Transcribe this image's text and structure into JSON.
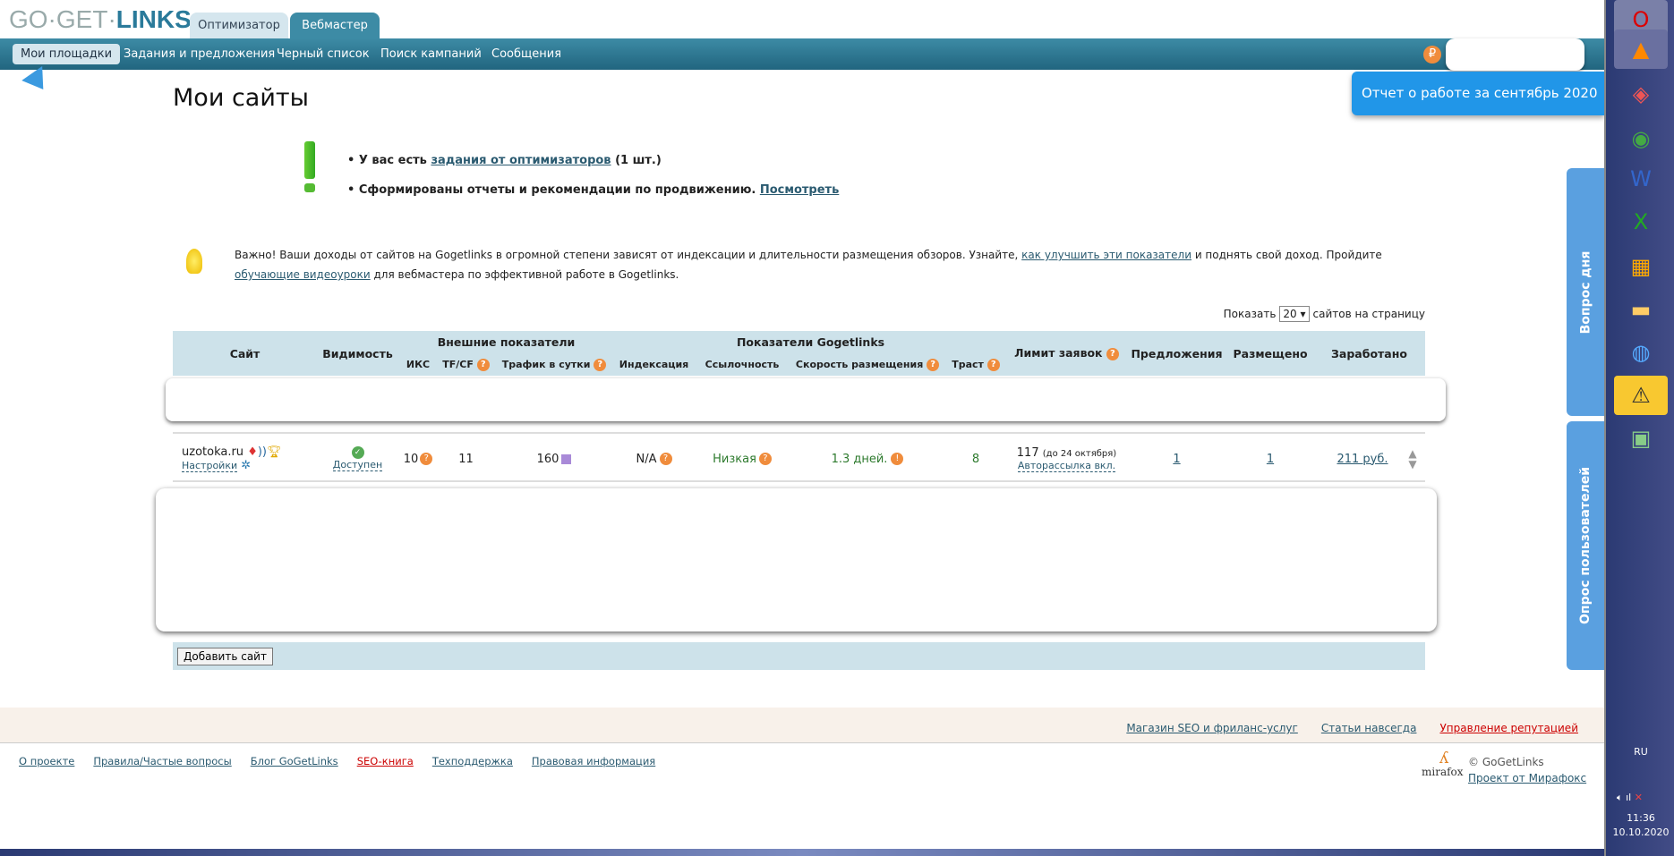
{
  "logo": {
    "part1": "GO·GET·",
    "part2": "LINKS"
  },
  "top_tabs": [
    {
      "label": "Оптимизатор"
    },
    {
      "label": "Вебмастер"
    }
  ],
  "nav": [
    {
      "label": "Мои площадки"
    },
    {
      "label": "Задания и предложения"
    },
    {
      "label": "Черный список"
    },
    {
      "label": "Поиск кампаний"
    },
    {
      "label": "Сообщения"
    }
  ],
  "balance_icon": "ruble-icon",
  "report_button": "Отчет о работе за сентябрь 2020",
  "page_title": "Мои сайты",
  "notices": {
    "n1_pre": "У вас есть ",
    "n1_link": "задания от оптимизаторов",
    "n1_post": " (1 шт.)",
    "n2_pre": "Сформированы отчеты и рекомендации по продвижению. ",
    "n2_link": "Посмотреть"
  },
  "tip": {
    "t1": "Важно! Ваши доходы от сайтов на Gogetlinks в огромной степени зависят от индексации и длительности размещения обзоров. Узнайте, ",
    "link1": "как улучшить эти показатели",
    "t2": " и поднять свой доход. Пройдите ",
    "link2": "обучающие видеоуроки",
    "t3": " для вебмастера по эффективной работе в Gogetlinks."
  },
  "pager": {
    "show": "Показать",
    "value": "20",
    "suffix": "сайтов на страницу"
  },
  "table": {
    "headers": {
      "site": "Сайт",
      "visibility": "Видимость",
      "external": "Внешние показатели",
      "iks": "ИКС",
      "tfcf": "TF/CF",
      "traffic": "Трафик в сутки",
      "ggl": "Показатели Gogetlinks",
      "indexing": "Индексация",
      "links": "Ссылочность",
      "speed": "Скорость размещения",
      "trust": "Траст",
      "limit": "Лимит заявок",
      "offers": "Предложения",
      "placed": "Размещено",
      "earned": "Заработано"
    },
    "rows": [
      {
        "site": "uzotoka.ru",
        "settings": "Настройки",
        "visibility": "Доступен",
        "iks": "10",
        "tfcf": "11",
        "traffic": "160",
        "indexing": "N/A",
        "links": "Низкая",
        "speed": "1.3 дней.",
        "trust": "8",
        "limit": "117",
        "limit_note": "(до 24 октября)",
        "autosend": "Авторассылка вкл.",
        "offers": "1",
        "placed": "1",
        "earned": "211 руб."
      }
    ]
  },
  "add_site": "Добавить сайт",
  "side_tabs": [
    "Вопрос дня",
    "Опрос пользователей"
  ],
  "footer": {
    "top_links": [
      "Магазин SEO и фриланс-услуг",
      "Статьи навсегда",
      "Управление репутацией"
    ],
    "links": [
      "О проекте",
      "Правила/Частые вопросы",
      "Блог GoGetLinks",
      "SEO-книга",
      "Техподдержка",
      "Правовая информация"
    ],
    "copyright": "© GoGetLinks",
    "project": "Проект от Мирафокс",
    "mirafox": "mirafox"
  },
  "taskbar": {
    "icons": [
      "opera-icon",
      "vlc-icon",
      "faststone-icon",
      "chrome-icon",
      "word-icon",
      "excel-icon",
      "app-icon",
      "folder-icon",
      "network-icon",
      "warning-icon",
      "monitor-icon"
    ],
    "lang": "RU",
    "time": "11:36",
    "date": "10.10.2020"
  },
  "colors": {
    "nav": "#2a7390",
    "accent_orange": "#f08c3c",
    "report_blue": "#2196e8",
    "green": "#2d7a2d"
  }
}
